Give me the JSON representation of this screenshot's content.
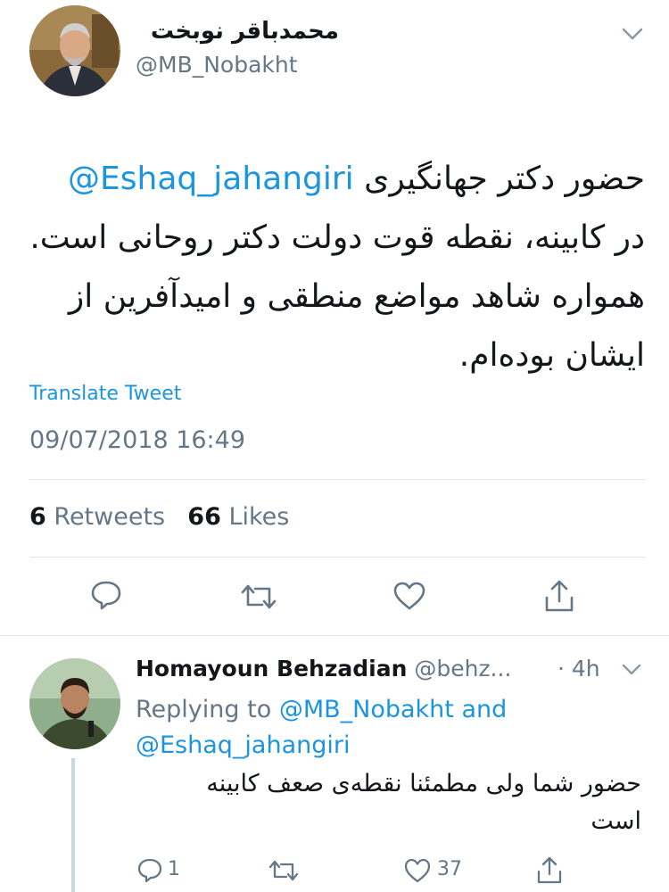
{
  "tweet": {
    "author_name": "محمدباقر نوبخت",
    "author_handle": "@MB_Nobakht",
    "mention": "@Eshaq_jahangiri",
    "line1_text": "حضور دکتر جهانگیری",
    "line2": "در کابینه، نقطه قوت دولت دکتر روحانی است.",
    "line3": "همواره شاهد مواضع منطقی و امیدآفرین از",
    "line4": "ایشان بوده‌ام.",
    "translate_label": "Translate Tweet",
    "timestamp": "09/07/2018 16:49",
    "retweets_count": "6",
    "retweets_label": "Retweets",
    "likes_count": "66",
    "likes_label": "Likes"
  },
  "reply": {
    "author_name": "Homayoun Behzadian",
    "author_handle": "@behz...",
    "time": "· 4h",
    "replying_prefix": "Replying to",
    "replying_to_1": "@MB_Nobakht",
    "and_word": "and",
    "replying_to_2": "@Eshaq_jahangiri",
    "text_line1": "حضور شما ولی مطمئنا نقطه‌ی صعف کابینه",
    "text_line2": "است",
    "reply_count": "1",
    "like_count": "37"
  },
  "colors": {
    "link": "#1b95e0",
    "muted": "#657786",
    "divider": "#e1e8ed"
  },
  "icons": [
    "chevron-down-icon",
    "reply-icon",
    "retweet-icon",
    "like-icon",
    "share-icon"
  ]
}
